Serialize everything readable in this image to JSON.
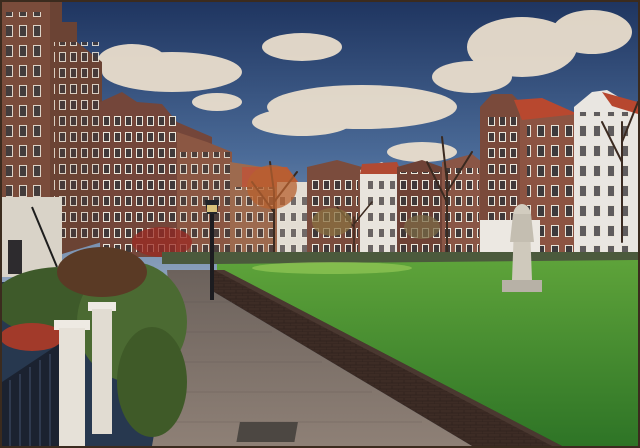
{
  "photo": {
    "subject": "courtyard-scene",
    "palette": {
      "sky_top": "#233a63",
      "sky_mid": "#4e6d9a",
      "cloud": "#f1e4d2",
      "brick_dark": "#5a3429",
      "brick_mid": "#7d4b3a",
      "white_house": "#e6e2dc",
      "roof_red": "#b44a32",
      "lawn": "#3f8a2f",
      "lawn_light": "#6fb444",
      "path": "#8a7b72",
      "wall": "#3a2a24",
      "fence": "#1e2430",
      "statue": "#c7c1b4"
    }
  }
}
